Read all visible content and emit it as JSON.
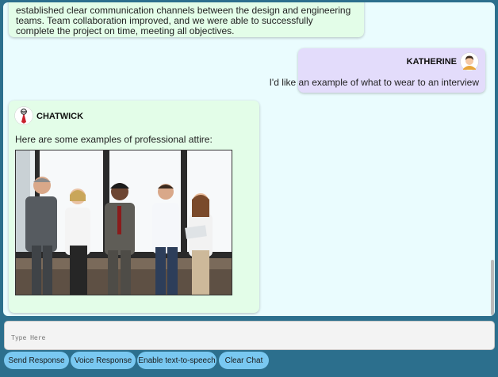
{
  "messages": [
    {
      "sender": "bot",
      "text": "established clear communication channels between the design and engineering teams. Team collaboration improved, and we were able to successfully complete the project on time, meeting all objectives."
    },
    {
      "sender": "user",
      "name": "KATHERINE",
      "avatar": "user-avatar-icon",
      "text": "I'd like an example of what to wear to an interview"
    },
    {
      "sender": "bot",
      "name": "CHATWICK",
      "avatar": "bot-avatar-icon",
      "text": "Here are some examples of professional attire:",
      "image": "office-team-photo"
    }
  ],
  "input": {
    "placeholder": "Type Here",
    "value": ""
  },
  "buttons": {
    "send": "Send Response",
    "voice": "Voice Response",
    "tts": "Enable text-to-speech",
    "clear": "Clear Chat"
  },
  "colors": {
    "background": "#2c6f8d",
    "chat_area": "#eafcfe",
    "bot_bubble": "#e3fde8",
    "user_bubble": "#e3dcfb",
    "button": "#79c8f1"
  }
}
